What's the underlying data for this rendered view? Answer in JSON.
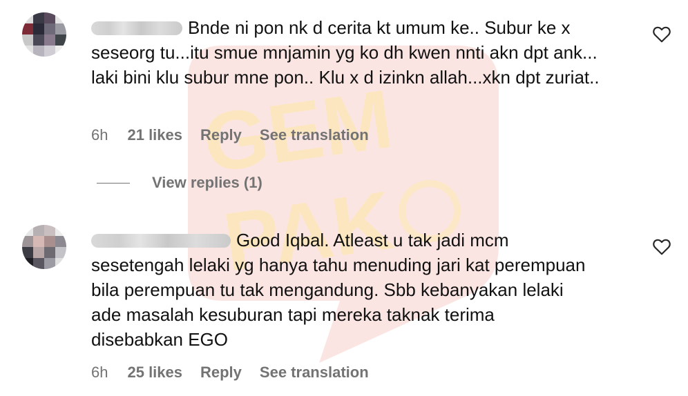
{
  "watermark": {
    "text_top": "GEM",
    "text_bottom": "PAK",
    "color": "#f4b4ac",
    "accent": "#fde8a4"
  },
  "comments": [
    {
      "text": "Bnde ni pon nk d cerita kt umum ke.. Subur ke x seseorg tu...itu smue mnjamin yg ko dh kwen nnti akn dpt ank... laki bini klu subur mne pon.. Klu x d izinkn allah...xkn dpt zuriat..",
      "timestamp": "6h",
      "likes": "21 likes",
      "reply_label": "Reply",
      "translation_label": "See translation",
      "like_icon": "heart-outline-icon"
    },
    {
      "text": "Good Iqbal. Atleast u tak jadi mcm sesetengah lelaki yg hanya tahu menuding jari kat perempuan bila perempuan tu tak mengandung. Sbb kebanyakan lelaki ade masalah kesuburan tapi mereka taknak terima disebabkan EGO",
      "timestamp": "6h",
      "likes": "25 likes",
      "reply_label": "Reply",
      "translation_label": "See translation",
      "like_icon": "heart-outline-icon"
    }
  ],
  "view_replies": "View replies (1)",
  "colors": {
    "secondary_text": "#737373",
    "primary_text": "#111111"
  }
}
